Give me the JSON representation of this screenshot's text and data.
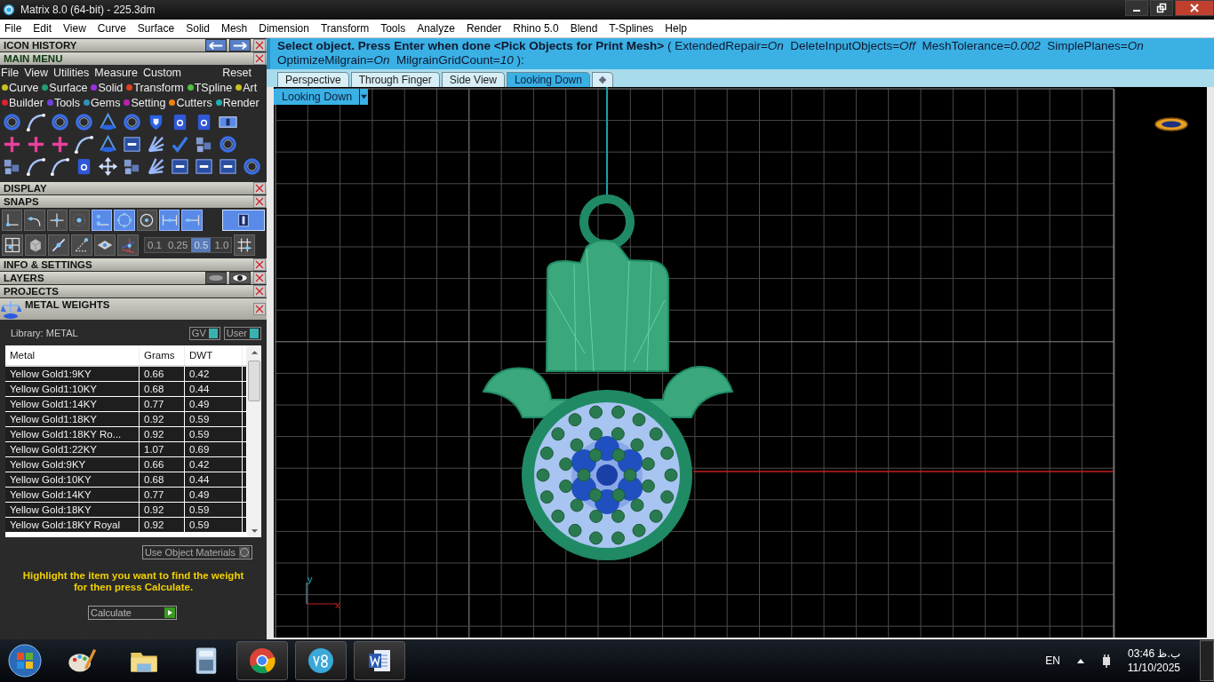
{
  "window": {
    "title": "Matrix 8.0 (64-bit) - 225.3dm"
  },
  "menu_bar": [
    "File",
    "Edit",
    "View",
    "Curve",
    "Surface",
    "Solid",
    "Mesh",
    "Dimension",
    "Transform",
    "Tools",
    "Analyze",
    "Render",
    "Rhino 5.0",
    "Blend",
    "T-Splines",
    "Help"
  ],
  "left_panel": {
    "icon_history": {
      "title": "ICON HISTORY"
    },
    "main_menu": {
      "title": "MAIN MENU",
      "menu": [
        "File",
        "View",
        "Utilities",
        "Measure",
        "Custom"
      ],
      "reset": "Reset",
      "category_rows": [
        [
          {
            "label": "Curve",
            "color": "#c8c020"
          },
          {
            "label": "Surface",
            "color": "#20a070"
          },
          {
            "label": "Solid",
            "color": "#9a30e0"
          },
          {
            "label": "Transform",
            "color": "#e04020"
          },
          {
            "label": "TSpline",
            "color": "#50c040"
          },
          {
            "label": "Art",
            "color": "#c8c020"
          }
        ],
        [
          {
            "label": "Builder",
            "color": "#e02030"
          },
          {
            "label": "Tools",
            "color": "#7040e0"
          },
          {
            "label": "Gems",
            "color": "#3090c0"
          },
          {
            "label": "Setting",
            "color": "#c020b0"
          },
          {
            "label": "Cutters",
            "color": "#f08010"
          },
          {
            "label": "Render",
            "color": "#20b0b0"
          }
        ]
      ]
    },
    "display": {
      "title": "DISPLAY"
    },
    "snaps": {
      "title": "SNAPS",
      "buttons": [
        {
          "on": false
        },
        {
          "on": false
        },
        {
          "on": false
        },
        {
          "on": false
        },
        {
          "on": true
        },
        {
          "on": true
        },
        {
          "on": false
        },
        {
          "on": true
        },
        {
          "on": true
        }
      ],
      "steps": [
        {
          "label": "0.1",
          "selected": false
        },
        {
          "label": "0.25",
          "selected": false
        },
        {
          "label": "0.5",
          "selected": true
        },
        {
          "label": "1.0",
          "selected": false
        }
      ]
    },
    "info_settings": {
      "title": "INFO & SETTINGS"
    },
    "layers": {
      "title": "LAYERS"
    },
    "projects": {
      "title": "PROJECTS"
    },
    "metal_weights": {
      "title": "METAL WEIGHTS",
      "library": "Library: METAL",
      "toggles": [
        {
          "label": "GV",
          "on": true
        },
        {
          "label": "User",
          "on": true
        }
      ],
      "columns": [
        "Metal",
        "Grams",
        "DWT"
      ],
      "rows": [
        [
          "Yellow Gold1:9KY",
          "0.66",
          "0.42"
        ],
        [
          "Yellow Gold1:10KY",
          "0.68",
          "0.44"
        ],
        [
          "Yellow Gold1:14KY",
          "0.77",
          "0.49"
        ],
        [
          "Yellow Gold1:18KY",
          "0.92",
          "0.59"
        ],
        [
          "Yellow Gold1:18KY Ro...",
          "0.92",
          "0.59"
        ],
        [
          "Yellow Gold1:22KY",
          "1.07",
          "0.69"
        ],
        [
          "Yellow Gold:9KY",
          "0.66",
          "0.42"
        ],
        [
          "Yellow Gold:10KY",
          "0.68",
          "0.44"
        ],
        [
          "Yellow Gold:14KY",
          "0.77",
          "0.49"
        ],
        [
          "Yellow Gold:18KY",
          "0.92",
          "0.59"
        ],
        [
          "Yellow Gold:18KY Royal",
          "0.92",
          "0.59"
        ]
      ],
      "use_object_materials": {
        "label": "Use Object Materials",
        "checked": false
      },
      "hint": "Highlight the item you want to find the weight for then press Calculate.",
      "calculate": "Calculate"
    }
  },
  "command_prompt": [
    "**Select object. Press Enter when done <Pick Objects for Print Mesh>** ( ExtendedRepair=*On*  DeleteInputObjects=*Off*  MeshTolerance=*0.002*  SimplePlanes=*On*",
    "OptimizeMilgrain=*On*  MilgrainGridCount=*10* ):"
  ],
  "viewport_tabs": [
    {
      "label": "Perspective",
      "selected": false
    },
    {
      "label": "Through Finger",
      "selected": false
    },
    {
      "label": "Side View",
      "selected": false
    },
    {
      "label": "Looking Down",
      "selected": true
    }
  ],
  "viewport": {
    "label": "Looking Down",
    "axis_y": "y",
    "axis_x": "x"
  },
  "taskbar": {
    "language": "EN",
    "time": "03:46 ب.ظ",
    "date": "11/10/2025"
  }
}
